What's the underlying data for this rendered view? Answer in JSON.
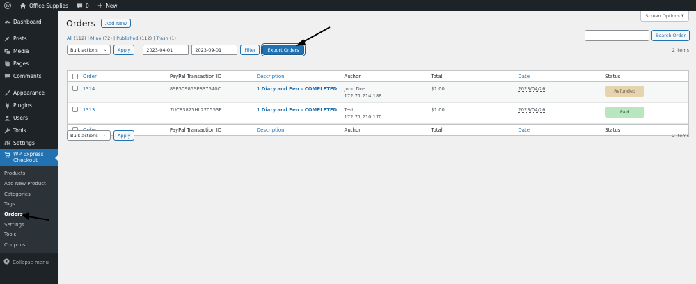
{
  "admin_bar": {
    "site_name": "Office Supplies",
    "comments_count": "0",
    "new_label": "New"
  },
  "sidebar": {
    "items": [
      {
        "label": "Dashboard",
        "icon": "dashboard-icon"
      },
      {
        "label": "Posts",
        "icon": "pin-icon"
      },
      {
        "label": "Media",
        "icon": "media-icon"
      },
      {
        "label": "Pages",
        "icon": "page-icon"
      },
      {
        "label": "Comments",
        "icon": "comment-icon"
      },
      {
        "label": "Appearance",
        "icon": "brush-icon"
      },
      {
        "label": "Plugins",
        "icon": "plugin-icon"
      },
      {
        "label": "Users",
        "icon": "user-icon"
      },
      {
        "label": "Tools",
        "icon": "wrench-icon"
      },
      {
        "label": "Settings",
        "icon": "settings-icon"
      }
    ],
    "current": {
      "label": "WP Express Checkout",
      "label_line1": "WP Express",
      "label_line2": "Checkout",
      "icon": "cart-icon"
    },
    "submenu": [
      "Products",
      "Add New Product",
      "Categories",
      "Tags",
      "Orders",
      "Settings",
      "Tools",
      "Coupons"
    ],
    "submenu_active": "Orders",
    "collapse_label": "Collapse menu"
  },
  "header": {
    "screen_options": "Screen Options",
    "title": "Orders",
    "add_new": "Add New"
  },
  "views": {
    "all": "All",
    "all_count": "(112)",
    "mine": "Mine",
    "mine_count": "(72)",
    "published": "Published",
    "published_count": "(112)",
    "trash": "Trash",
    "trash_count": "(1)"
  },
  "search": {
    "button": "Search Order",
    "value": ""
  },
  "toolbar_top": {
    "bulk_actions": "Bulk actions",
    "apply": "Apply",
    "date_from": "2023-04-01",
    "date_to": "2023-09-01",
    "filter": "Filter",
    "export": "Export Orders",
    "items_count": "2 items"
  },
  "toolbar_bottom": {
    "bulk_actions": "Bulk actions",
    "apply": "Apply",
    "items_count": "2 items"
  },
  "table": {
    "columns": [
      "Order",
      "PayPal Transaction ID",
      "Description",
      "Author",
      "Total",
      "Date",
      "Status"
    ],
    "rows": [
      {
        "order": "1314",
        "txn": "8SP50985SP837540C",
        "description": "1 Diary and Pen – COMPLETED",
        "author": "John Doe",
        "ip": "172.71.214.188",
        "total": "$1.00",
        "date": "2023/04/26",
        "status": "Refunded"
      },
      {
        "order": "1313",
        "txn": "7UC83825HL270553E",
        "description": "1 Diary and Pen – COMPLETED",
        "author": "Test",
        "ip": "172.71.210.170",
        "total": "$1.00",
        "date": "2023/04/26",
        "status": "Paid"
      }
    ]
  },
  "colors": {
    "refunded_bg": "#e5d4b0",
    "paid_bg": "#b8e6bf",
    "accent": "#2271b1",
    "sidebar_bg": "#1d2327"
  }
}
